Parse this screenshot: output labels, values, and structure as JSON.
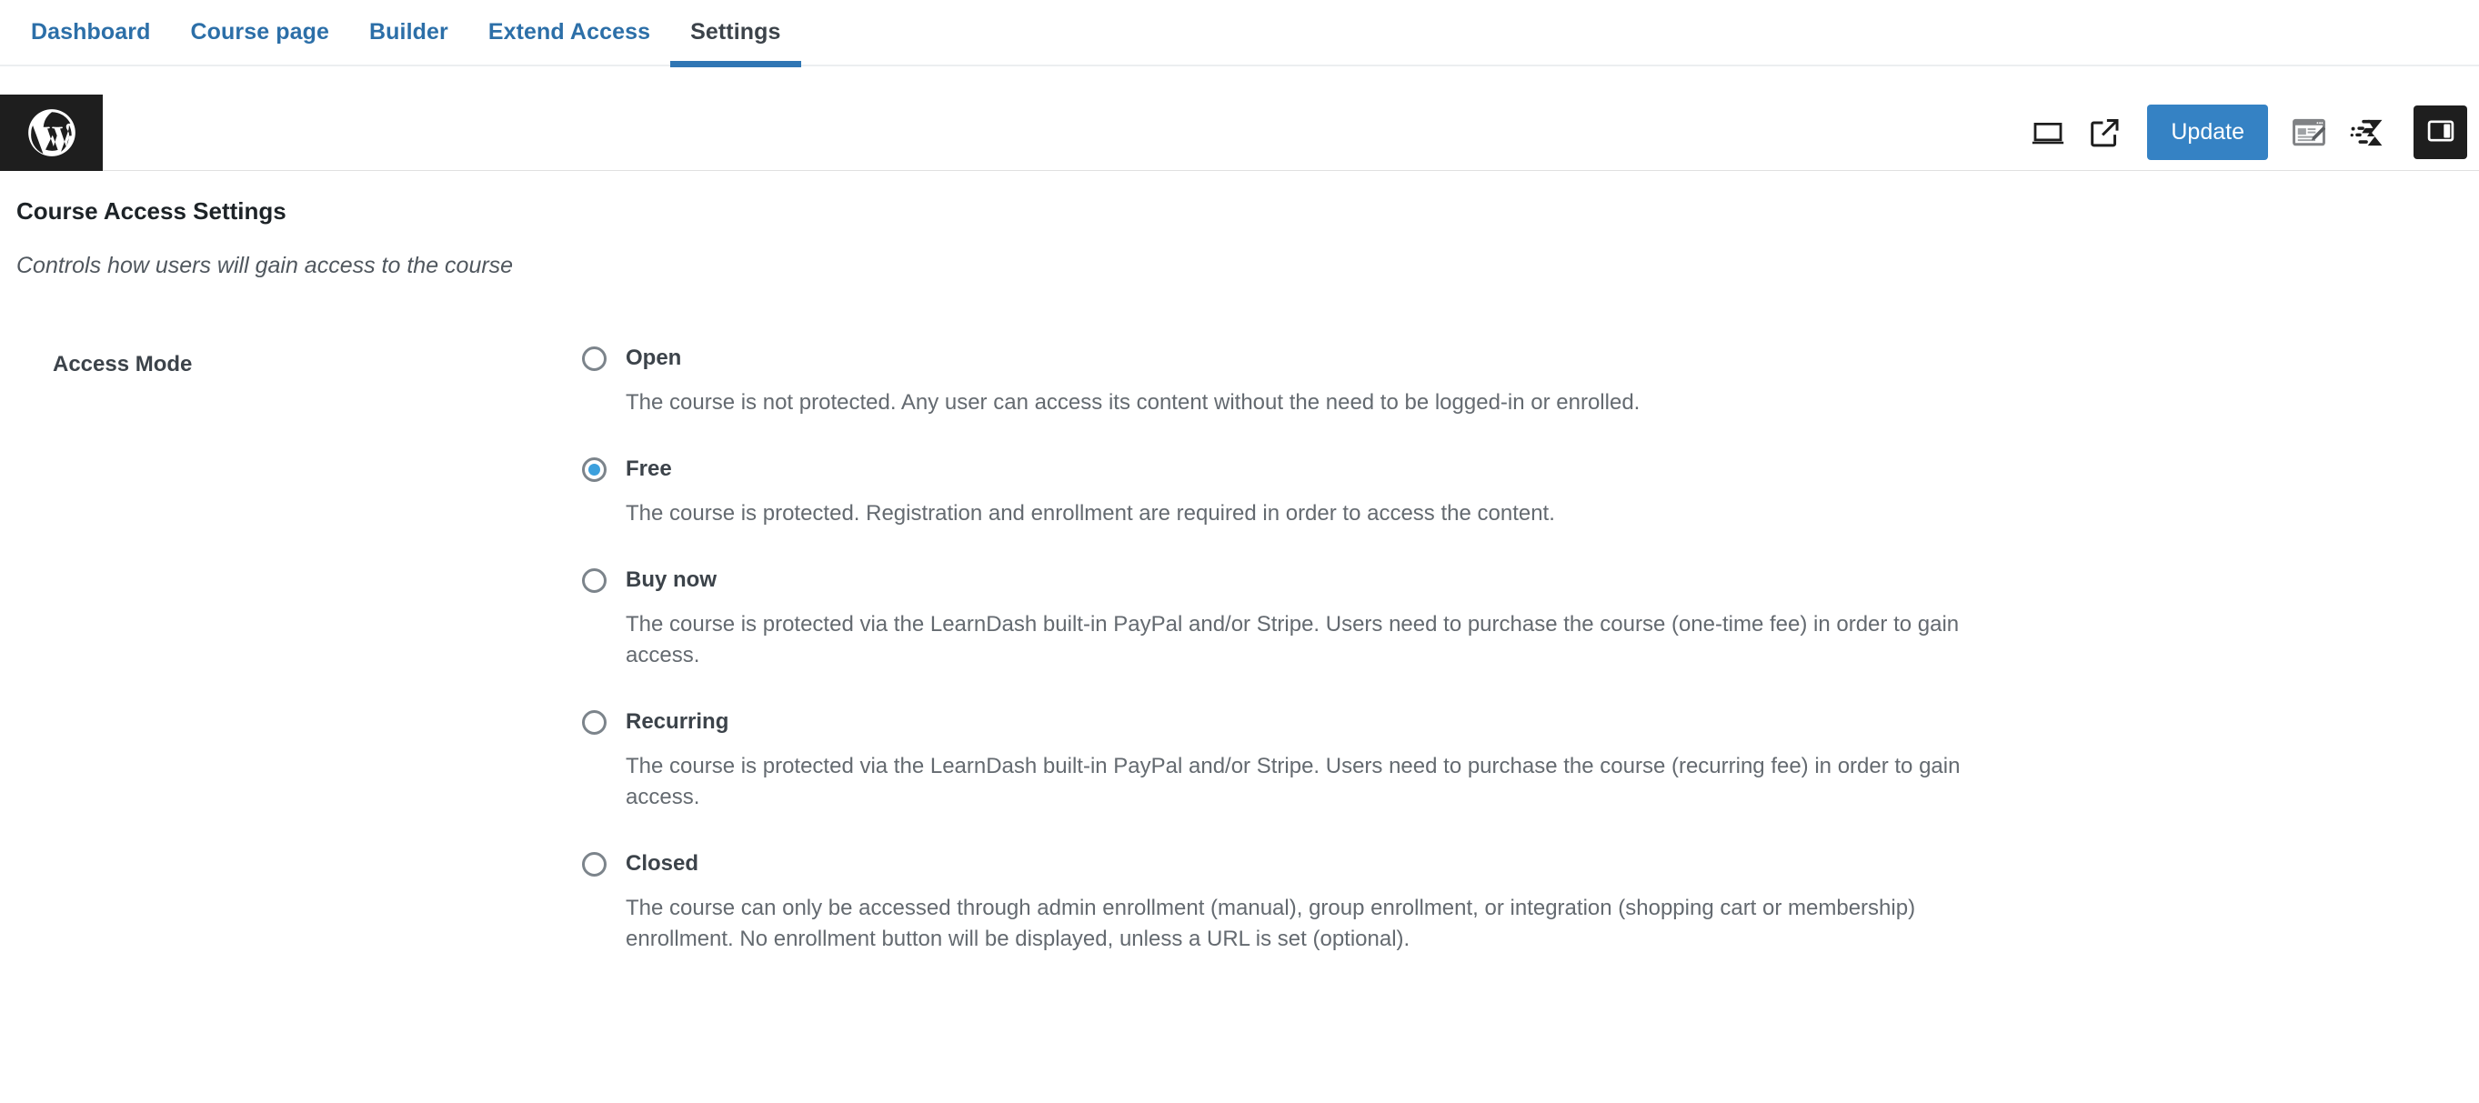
{
  "nav": {
    "tabs": [
      {
        "label": "Dashboard",
        "active": false
      },
      {
        "label": "Course page",
        "active": false
      },
      {
        "label": "Builder",
        "active": false
      },
      {
        "label": "Extend Access",
        "active": false
      },
      {
        "label": "Settings",
        "active": true
      }
    ]
  },
  "header": {
    "wp_logo_icon": "wordpress-logo-icon",
    "view_icon": "desktop-view-icon",
    "preview_icon": "external-link-preview-icon",
    "update_label": "Update",
    "edit_post_icon": "edit-post-icon",
    "learndash_icon": "learndash-logo-icon",
    "sidebar_toggle_icon": "sidebar-layout-icon",
    "accent_color": "#3582c4",
    "dark_color": "#1e1e1e"
  },
  "settings": {
    "title": "Course Access Settings",
    "subtitle": "Controls how users will gain access to the course",
    "access_mode": {
      "label": "Access Mode",
      "selected": "Free",
      "options": [
        {
          "label": "Open",
          "checked": false,
          "description": "The course is not protected. Any user can access its content without the need to be logged-in or enrolled."
        },
        {
          "label": "Free",
          "checked": true,
          "description": "The course is protected. Registration and enrollment are required in order to access the content."
        },
        {
          "label": "Buy now",
          "checked": false,
          "description": "The course is protected via the LearnDash built-in PayPal and/or Stripe. Users need to purchase the course (one-time fee) in order to gain access."
        },
        {
          "label": "Recurring",
          "checked": false,
          "description": "The course is protected via the LearnDash built-in PayPal and/or Stripe. Users need to purchase the course (recurring fee) in order to gain access."
        },
        {
          "label": "Closed",
          "checked": false,
          "description": "The course can only be accessed through admin enrollment (manual), group enrollment, or integration (shopping cart or membership) enrollment. No enrollment button will be displayed, unless a URL is set (optional)."
        }
      ]
    }
  }
}
